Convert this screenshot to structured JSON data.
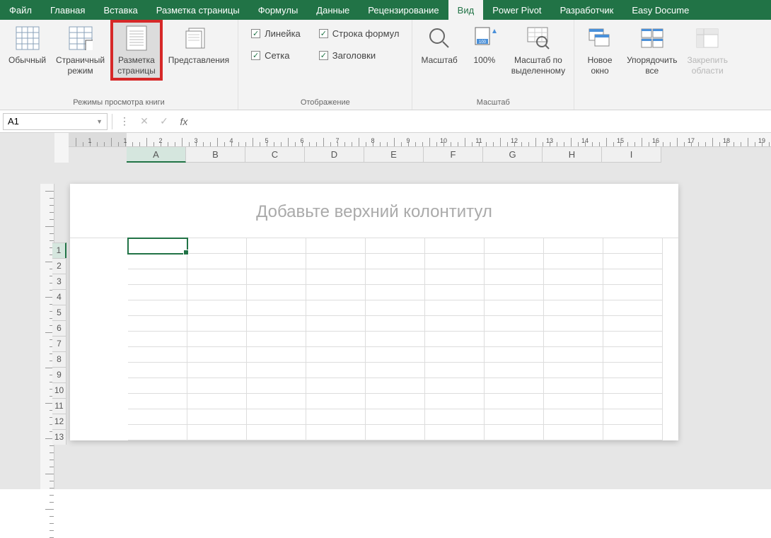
{
  "menu": {
    "tabs": [
      "Файл",
      "Главная",
      "Вставка",
      "Разметка страницы",
      "Формулы",
      "Данные",
      "Рецензирование",
      "Вид",
      "Power Pivot",
      "Разработчик",
      "Easy Docume"
    ],
    "active_index": 7
  },
  "ribbon": {
    "group_views": {
      "label": "Режимы просмотра книги",
      "normal": "Обычный",
      "page_break": "Страничный\nрежим",
      "page_layout": "Разметка\nстраницы",
      "custom_views": "Представления"
    },
    "group_show": {
      "label": "Отображение",
      "ruler": "Линейка",
      "gridlines": "Сетка",
      "formula_bar": "Строка формул",
      "headings": "Заголовки"
    },
    "group_zoom": {
      "label": "Масштаб",
      "zoom": "Масштаб",
      "hundred": "100%",
      "zoom_selection": "Масштаб по\nвыделенному"
    },
    "group_window": {
      "new_window": "Новое\nокно",
      "arrange": "Упорядочить\nвсе",
      "freeze": "Закрепить\nобласти"
    }
  },
  "formula_bar": {
    "cell_ref": "A1"
  },
  "sheet": {
    "header_placeholder": "Добавьте верхний колонтитул",
    "columns": [
      "A",
      "B",
      "C",
      "D",
      "E",
      "F",
      "G",
      "H",
      "I"
    ],
    "rows": [
      "1",
      "2",
      "3",
      "4",
      "5",
      "6",
      "7",
      "8",
      "9",
      "10",
      "11",
      "12",
      "13"
    ],
    "hruler_nums": [
      "1",
      "1",
      "2",
      "3",
      "4",
      "5",
      "6",
      "7",
      "8",
      "9",
      "10",
      "11",
      "12",
      "13",
      "14",
      "15",
      "16",
      "17",
      "18",
      "19"
    ]
  }
}
